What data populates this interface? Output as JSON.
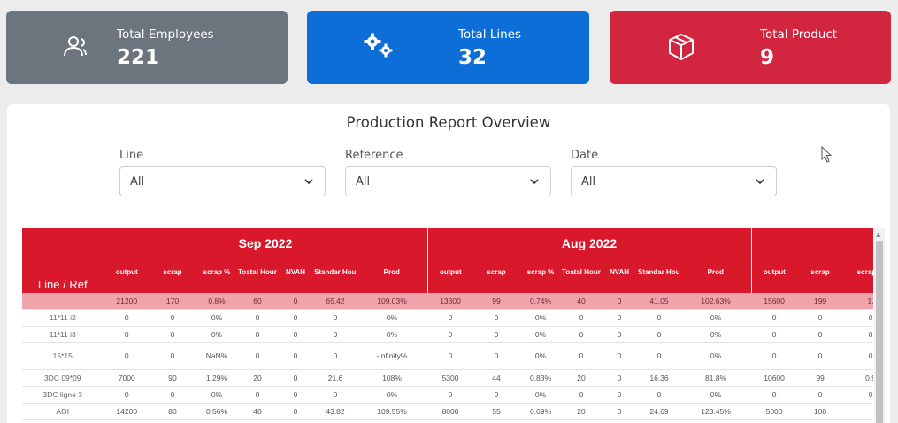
{
  "cards": [
    {
      "label": "Total Employees",
      "value": "221",
      "icon": "users-icon",
      "color": "#6c757d"
    },
    {
      "label": "Total Lines",
      "value": "32",
      "icon": "gears-icon",
      "color": "#0e6ed8"
    },
    {
      "label": "Total Product",
      "value": "9",
      "icon": "box-icon",
      "color": "#d22640"
    }
  ],
  "report": {
    "title": "Production Report Overview",
    "filters": [
      {
        "label": "Line",
        "value": "All"
      },
      {
        "label": "Reference",
        "value": "All"
      },
      {
        "label": "Date",
        "value": "All"
      }
    ],
    "table": {
      "row_header": "Line / Ref",
      "months": [
        "Sep 2022",
        "Aug 2022",
        ""
      ],
      "columns": [
        "output",
        "scrap",
        "scrap %",
        "Toatal Hours",
        "NVAH",
        "Standar Hour",
        "Prod"
      ],
      "total_row": [
        [
          "21200",
          "170",
          "0.8%",
          "60",
          "0",
          "65.42",
          "109.03%"
        ],
        [
          "13300",
          "99",
          "0.74%",
          "40",
          "0",
          "41.05",
          "102.63%"
        ],
        [
          "15600",
          "199",
          "1."
        ]
      ],
      "rows": [
        {
          "ref": "11*11 i2",
          "cells": [
            [
              "0",
              "0",
              "0%",
              "0",
              "0",
              "0",
              "0%"
            ],
            [
              "0",
              "0",
              "0%",
              "0",
              "0",
              "0",
              "0%"
            ],
            [
              "0",
              "0",
              "0"
            ]
          ]
        },
        {
          "ref": "11*11 i3",
          "cells": [
            [
              "0",
              "0",
              "0%",
              "0",
              "0",
              "0",
              "0%"
            ],
            [
              "0",
              "0",
              "0%",
              "0",
              "0",
              "0",
              "0%"
            ],
            [
              "0",
              "0",
              "0"
            ]
          ]
        },
        {
          "ref": "15*15",
          "cells": [
            [
              "0",
              "0",
              "NaN%",
              "0",
              "0",
              "0",
              "-Infinity%"
            ],
            [
              "0",
              "0",
              "0%",
              "0",
              "0",
              "0",
              "0%"
            ],
            [
              "0",
              "0",
              "0"
            ]
          ]
        },
        {
          "ref": "3DC 09*09",
          "cells": [
            [
              "7000",
              "90",
              "1.29%",
              "20",
              "0",
              "21.6",
              "108%"
            ],
            [
              "5300",
              "44",
              "0.83%",
              "20",
              "0",
              "16.36",
              "81.8%"
            ],
            [
              "10600",
              "99",
              "0.9"
            ]
          ]
        },
        {
          "ref": "3DC ligne 3",
          "cells": [
            [
              "0",
              "0",
              "0%",
              "0",
              "0",
              "0",
              "0%"
            ],
            [
              "0",
              "0",
              "0%",
              "0",
              "0",
              "0",
              "0%"
            ],
            [
              "0",
              "0",
              "0"
            ]
          ]
        },
        {
          "ref": "AOI",
          "cells": [
            [
              "14200",
              "80",
              "0.56%",
              "40",
              "0",
              "43.82",
              "109.55%"
            ],
            [
              "8000",
              "55",
              "0.69%",
              "20",
              "0",
              "24.69",
              "123.45%"
            ],
            [
              "5000",
              "100",
              ""
            ]
          ]
        }
      ]
    }
  }
}
